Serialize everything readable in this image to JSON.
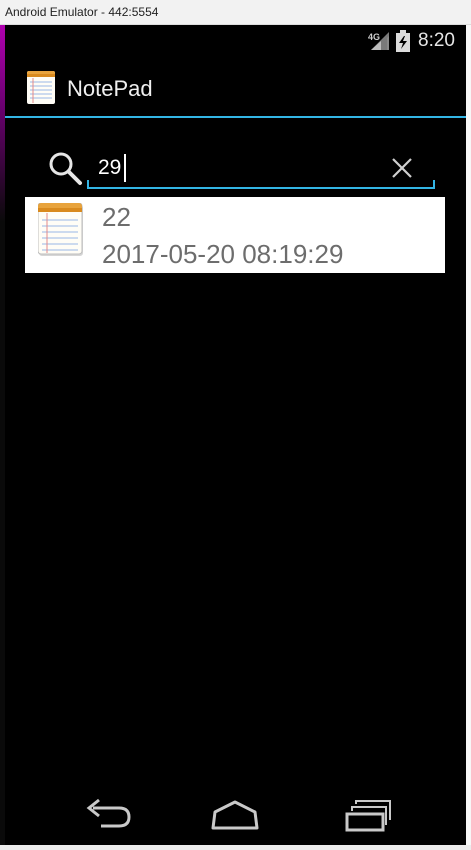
{
  "window": {
    "title": "Android Emulator - 442:5554"
  },
  "status_bar": {
    "network": "4G",
    "time": "8:20"
  },
  "action_bar": {
    "app_title": "NotePad",
    "app_icon": "notepad-icon"
  },
  "search": {
    "query": "29",
    "search_icon": "magnifier-icon",
    "clear_icon": "close-x-icon"
  },
  "results": [
    {
      "title": "22",
      "date": "2017-05-20 08:19:29",
      "icon": "notepad-icon"
    }
  ],
  "nav_bar": {
    "back_icon": "back-arrow-icon",
    "home_icon": "home-icon",
    "recents_icon": "recent-apps-icon"
  },
  "colors": {
    "accent": "#33b5e5",
    "background": "#000000",
    "list_item_bg": "#ffffff",
    "list_text": "#6d6d6d"
  }
}
